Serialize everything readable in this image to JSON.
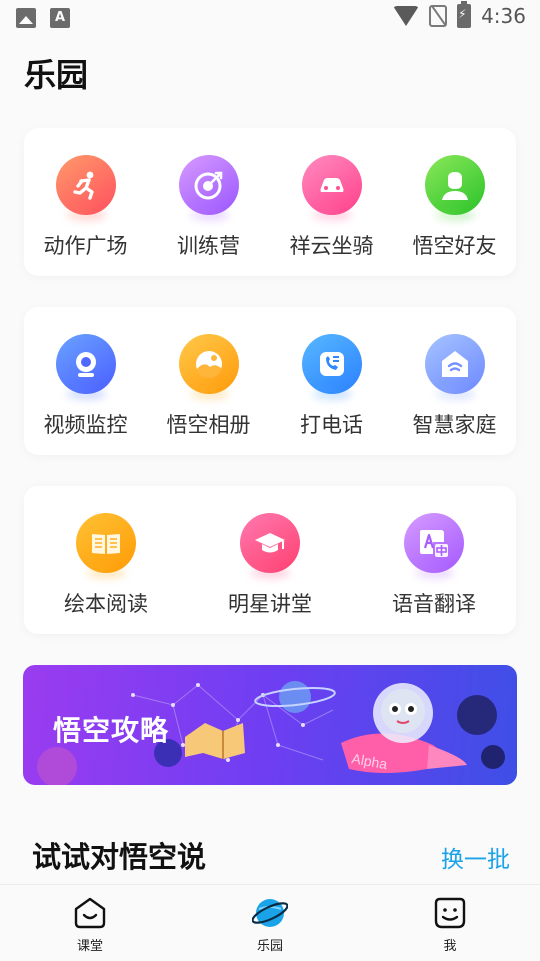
{
  "status_bar": {
    "time": "4:36",
    "icons": [
      "image-icon",
      "text-a-icon",
      "wifi-icon",
      "no-sim-icon",
      "battery-charging-icon"
    ]
  },
  "page_title": "乐园",
  "grid_cards": [
    {
      "items": [
        {
          "label": "动作广场",
          "icon": "running-person-icon",
          "color": "#ff5e5e"
        },
        {
          "label": "训练营",
          "icon": "target-icon",
          "color": "#a35cff"
        },
        {
          "label": "祥云坐骑",
          "icon": "car-icon",
          "color": "#ff4f93"
        },
        {
          "label": "悟空好友",
          "icon": "friend-avatar-icon",
          "color": "#35c72f"
        }
      ]
    },
    {
      "items": [
        {
          "label": "视频监控",
          "icon": "camera-icon",
          "color": "#4f66ff"
        },
        {
          "label": "悟空相册",
          "icon": "photo-icon",
          "color": "#ffa11a"
        },
        {
          "label": "打电话",
          "icon": "phone-icon",
          "color": "#2f88ff"
        },
        {
          "label": "智慧家庭",
          "icon": "smart-home-icon",
          "color": "#7590ff"
        }
      ]
    },
    {
      "items": [
        {
          "label": "绘本阅读",
          "icon": "book-icon",
          "color": "#ff9f0d"
        },
        {
          "label": "明星讲堂",
          "icon": "graduation-cap-icon",
          "color": "#ff4577"
        },
        {
          "label": "语音翻译",
          "icon": "translate-icon",
          "color": "#a95fff"
        }
      ]
    }
  ],
  "banner": {
    "title": "悟空攻略",
    "rocket_text": "Alpha"
  },
  "section": {
    "title": "试试对悟空说",
    "refresh_label": "换一批"
  },
  "tabbar": [
    {
      "label": "课堂",
      "icon": "classroom-face-icon",
      "active": false
    },
    {
      "label": "乐园",
      "icon": "planet-icon",
      "active": true
    },
    {
      "label": "我",
      "icon": "smile-face-icon",
      "active": false
    }
  ],
  "colors": {
    "accent": "#1aa3e8",
    "banner_start": "#9b3cf0",
    "banner_end": "#3e4fe6"
  }
}
